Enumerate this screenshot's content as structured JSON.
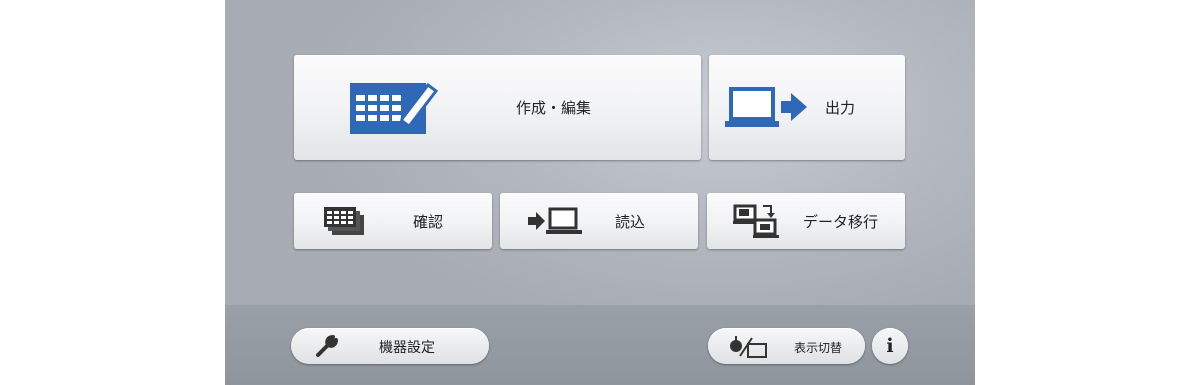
{
  "tiles": {
    "create_edit": {
      "label": "作成・編集",
      "icon": "calendar-pencil-icon"
    },
    "output": {
      "label": "出力",
      "icon": "laptop-arrow-out-icon"
    },
    "confirm": {
      "label": "確認",
      "icon": "calendar-stack-icon"
    },
    "import": {
      "label": "読込",
      "icon": "arrow-into-laptop-icon"
    },
    "data_migration": {
      "label": "データ移行",
      "icon": "data-transfer-icon"
    }
  },
  "footer": {
    "device_settings": {
      "label": "機器設定",
      "icon": "wrench-icon"
    },
    "display_switch": {
      "label": "表示切替",
      "icon": "display-toggle-icon"
    },
    "info": {
      "label": "i",
      "icon": "info-icon"
    }
  },
  "colors": {
    "accent_blue": "#2f68b6",
    "panel_gray": "#b3b8c0",
    "footer_gray": "#959ba3"
  }
}
